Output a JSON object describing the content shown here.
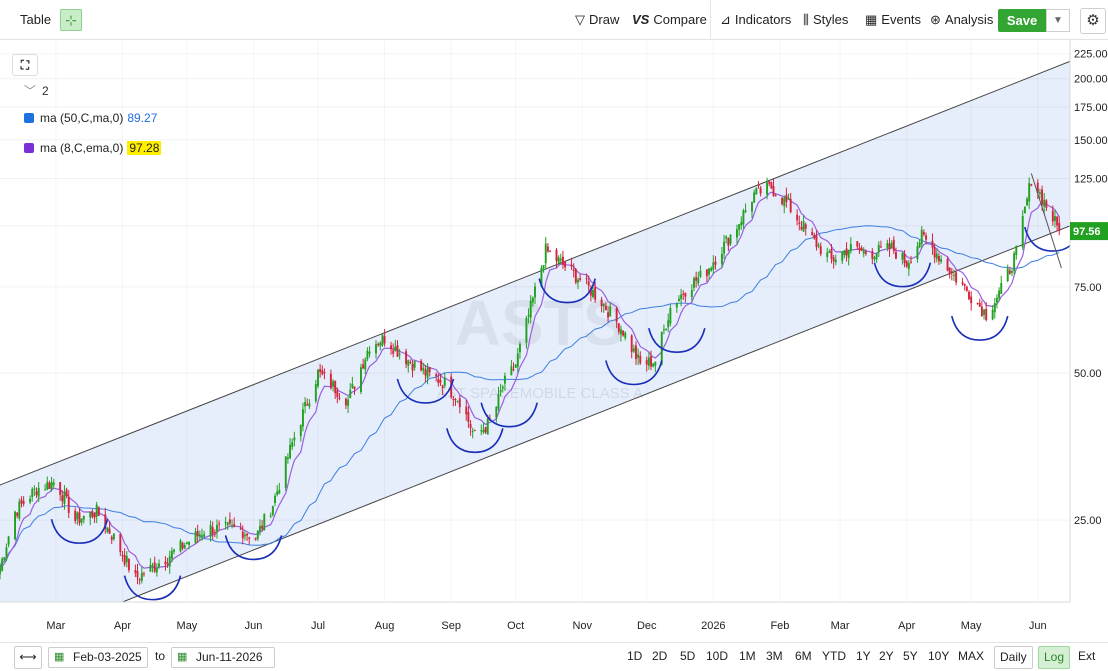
{
  "toolbar": {
    "table_label": "Table",
    "draw_label": "Draw",
    "compare_label": "Compare",
    "indicators_label": "Indicators",
    "styles_label": "Styles",
    "events_label": "Events",
    "analysis_label": "Analysis",
    "save_label": "Save"
  },
  "legend": {
    "collapse_count": "2",
    "studies": [
      {
        "name": "ma (50,C,ma,0)",
        "value": "89.27",
        "color": "#1e6fe0"
      },
      {
        "name": "ma (8,C,ema,0)",
        "value": "97.28",
        "color": "#7b2fd6",
        "highlight": "#ffee00"
      }
    ]
  },
  "watermark": {
    "symbol": "ASTS",
    "name": "AST SPACEMOBILE CLASS A"
  },
  "price_label": {
    "value": "97.56",
    "color": "#22a022"
  },
  "colors": {
    "up": "#22a022",
    "down": "#d4243c",
    "channel_fill": "#e6eefc",
    "arc": "#1a2fb8"
  },
  "chart_data": {
    "type": "candlestick",
    "y_scale": "log",
    "ylim": [
      17,
      240
    ],
    "xlim": [
      "2025-02-03",
      "2026-06-16"
    ],
    "y_ticks": [
      "225.00",
      "200.00",
      "175.00",
      "150.00",
      "125.00",
      "100.00",
      "75.00",
      "50.00",
      "25.00"
    ],
    "x_ticks": [
      "Mar",
      "Apr",
      "May",
      "Jun",
      "Jul",
      "Aug",
      "Sep",
      "Oct",
      "Nov",
      "Dec",
      "2026",
      "Feb",
      "Mar",
      "Apr",
      "May",
      "Jun"
    ],
    "price_path": [
      [
        "2025-02-03",
        20
      ],
      [
        "2025-02-10",
        26
      ],
      [
        "2025-02-20",
        29
      ],
      [
        "2025-03-01",
        30
      ],
      [
        "2025-03-10",
        25
      ],
      [
        "2025-03-20",
        26
      ],
      [
        "2025-03-28",
        23
      ],
      [
        "2025-04-07",
        19
      ],
      [
        "2025-04-15",
        20
      ],
      [
        "2025-04-28",
        22
      ],
      [
        "2025-05-10",
        24
      ],
      [
        "2025-05-25",
        24
      ],
      [
        "2025-06-02",
        23
      ],
      [
        "2025-06-10",
        27
      ],
      [
        "2025-06-20",
        37
      ],
      [
        "2025-07-01",
        50
      ],
      [
        "2025-07-08",
        47
      ],
      [
        "2025-07-15",
        44
      ],
      [
        "2025-07-25",
        57
      ],
      [
        "2025-08-01",
        59
      ],
      [
        "2025-08-10",
        54
      ],
      [
        "2025-08-20",
        50
      ],
      [
        "2025-08-28",
        48
      ],
      [
        "2025-09-05",
        44
      ],
      [
        "2025-09-12",
        37
      ],
      [
        "2025-09-20",
        40
      ],
      [
        "2025-09-25",
        47
      ],
      [
        "2025-10-01",
        52
      ],
      [
        "2025-10-08",
        68
      ],
      [
        "2025-10-15",
        89
      ],
      [
        "2025-10-22",
        84
      ],
      [
        "2025-11-01",
        77
      ],
      [
        "2025-11-10",
        70
      ],
      [
        "2025-11-20",
        61
      ],
      [
        "2025-11-28",
        52
      ],
      [
        "2025-12-05",
        53
      ],
      [
        "2025-12-12",
        68
      ],
      [
        "2025-12-20",
        75
      ],
      [
        "2025-12-28",
        80
      ],
      [
        "2026-01-05",
        90
      ],
      [
        "2026-01-12",
        100
      ],
      [
        "2026-01-20",
        116
      ],
      [
        "2026-01-28",
        120
      ],
      [
        "2026-02-05",
        110
      ],
      [
        "2026-02-15",
        95
      ],
      [
        "2026-02-25",
        85
      ],
      [
        "2026-03-05",
        90
      ],
      [
        "2026-03-15",
        88
      ],
      [
        "2026-03-25",
        90
      ],
      [
        "2026-04-01",
        84
      ],
      [
        "2026-04-08",
        95
      ],
      [
        "2026-04-15",
        88
      ],
      [
        "2026-04-22",
        80
      ],
      [
        "2026-05-01",
        72
      ],
      [
        "2026-05-08",
        66
      ],
      [
        "2026-05-15",
        74
      ],
      [
        "2026-05-22",
        88
      ],
      [
        "2026-05-29",
        125
      ],
      [
        "2026-06-04",
        112
      ],
      [
        "2026-06-11",
        97.56
      ]
    ],
    "channel": {
      "upper": [
        [
          "2025-02-03",
          29.5
        ],
        [
          "2026-06-16",
          217
        ]
      ],
      "lower": [
        [
          "2025-04-01",
          17
        ],
        [
          "2026-06-16",
          100
        ]
      ]
    },
    "pullback_arcs": [
      "2025-03-12",
      "2025-04-15",
      "2025-06-01",
      "2025-08-20",
      "2025-09-12",
      "2025-09-28",
      "2025-10-25",
      "2025-11-25",
      "2025-12-15",
      "2026-03-30",
      "2026-05-05",
      "2026-06-08"
    ],
    "series": [
      {
        "name": "ma (50,C,ma,0)",
        "last": 89.27
      },
      {
        "name": "ma (8,C,ema,0)",
        "last": 97.28
      }
    ]
  },
  "bottom": {
    "from_date": "Feb-03-2025",
    "to_label": "to",
    "to_date": "Jun-11-2026",
    "ranges": [
      "1D",
      "2D",
      "5D",
      "10D",
      "1M",
      "3M",
      "6M",
      "YTD",
      "1Y",
      "2Y",
      "5Y",
      "10Y",
      "MAX"
    ],
    "period": "Daily",
    "log_label": "Log",
    "ext_label": "Ext"
  }
}
